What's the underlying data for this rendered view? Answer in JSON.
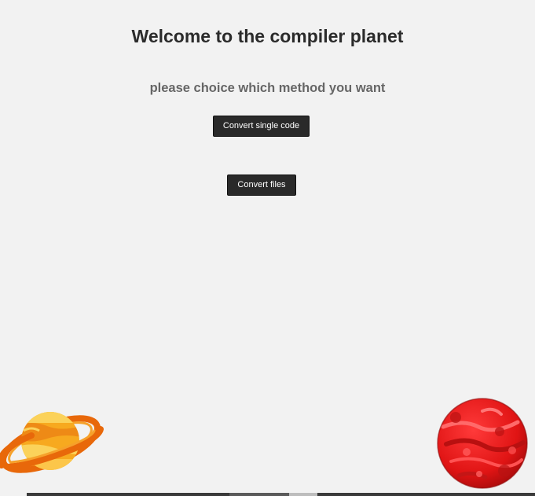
{
  "page": {
    "title": "Welcome to the compiler planet",
    "subtitle": "please choice which method you want"
  },
  "buttons": {
    "single": "Convert single code",
    "files": "Convert files"
  },
  "colors": {
    "background": "#f2f2f2",
    "title": "#2b2b2b",
    "subtitle": "#666666",
    "button_bg": "#2a2a2a",
    "button_text": "#ffffff"
  },
  "icons": {
    "left": "ringed-planet-icon",
    "right": "red-planet-icon"
  }
}
